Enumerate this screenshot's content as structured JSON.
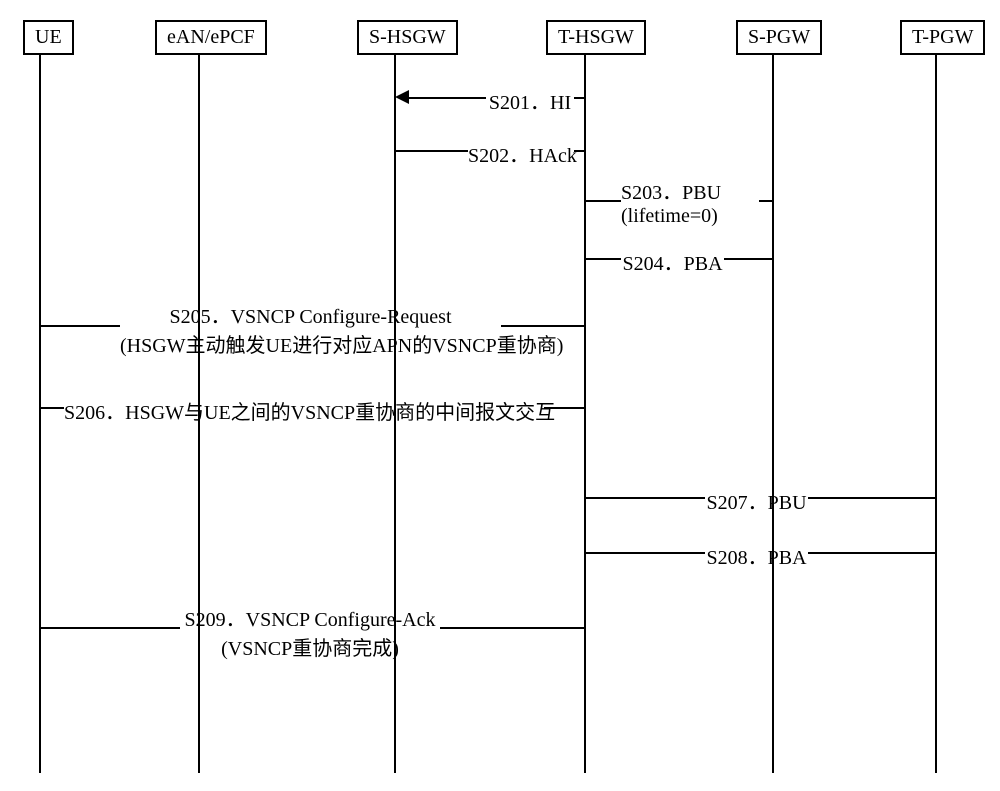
{
  "participants": {
    "ue": "UE",
    "ean": "eAN/ePCF",
    "shsgw": "S-HSGW",
    "thsgw": "T-HSGW",
    "spgw": "S-PGW",
    "tpgw": "T-PGW"
  },
  "messages": {
    "s201": "S201．HI",
    "s202": "S202．HAck",
    "s203_l1": "S203．PBU",
    "s203_l2": "(lifetime=0)",
    "s204": "S204．PBA",
    "s205_l1": "S205．VSNCP Configure-Request",
    "s205_l2": "(HSGW主动触发UE进行对应APN的VSNCP重协商)",
    "s206": "S206．HSGW与UE之间的VSNCP重协商的中间报文交互",
    "s207": "S207．PBU",
    "s208": "S208．PBA",
    "s209_l1": "S209．VSNCP Configure-Ack",
    "s209_l2": "(VSNCP重协商完成)"
  }
}
